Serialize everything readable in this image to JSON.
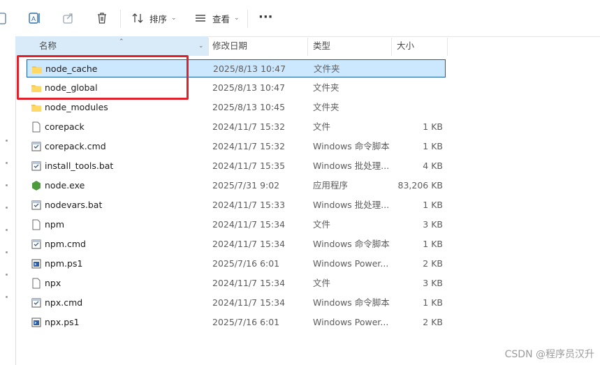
{
  "toolbar": {
    "sort_label": "排序",
    "view_label": "查看",
    "more_label": "···"
  },
  "columns": {
    "name": "名称",
    "date": "修改日期",
    "type": "类型",
    "size": "大小"
  },
  "files": [
    {
      "name": "node_cache",
      "date": "2025/8/13 10:47",
      "type": "文件夹",
      "size": "",
      "icon": "folder-icon"
    },
    {
      "name": "node_global",
      "date": "2025/8/13 10:47",
      "type": "文件夹",
      "size": "",
      "icon": "folder-icon"
    },
    {
      "name": "node_modules",
      "date": "2025/8/13 10:45",
      "type": "文件夹",
      "size": "",
      "icon": "folder-icon"
    },
    {
      "name": "corepack",
      "date": "2024/11/7 15:32",
      "type": "文件",
      "size": "1 KB",
      "icon": "file-icon"
    },
    {
      "name": "corepack.cmd",
      "date": "2024/11/7 15:32",
      "type": "Windows 命令脚本",
      "size": "1 KB",
      "icon": "script-icon"
    },
    {
      "name": "install_tools.bat",
      "date": "2024/11/7 15:35",
      "type": "Windows 批处理...",
      "size": "4 KB",
      "icon": "script-icon"
    },
    {
      "name": "node.exe",
      "date": "2025/7/31 9:02",
      "type": "应用程序",
      "size": "83,206 KB",
      "icon": "nodejs-icon"
    },
    {
      "name": "nodevars.bat",
      "date": "2024/11/7 15:33",
      "type": "Windows 批处理...",
      "size": "1 KB",
      "icon": "script-icon"
    },
    {
      "name": "npm",
      "date": "2024/11/7 15:34",
      "type": "文件",
      "size": "3 KB",
      "icon": "file-icon"
    },
    {
      "name": "npm.cmd",
      "date": "2024/11/7 15:34",
      "type": "Windows 命令脚本",
      "size": "1 KB",
      "icon": "script-icon"
    },
    {
      "name": "npm.ps1",
      "date": "2025/7/16 6:01",
      "type": "Windows Power...",
      "size": "2 KB",
      "icon": "powershell-icon"
    },
    {
      "name": "npx",
      "date": "2024/11/7 15:34",
      "type": "文件",
      "size": "3 KB",
      "icon": "file-icon"
    },
    {
      "name": "npx.cmd",
      "date": "2024/11/7 15:34",
      "type": "Windows 命令脚本",
      "size": "1 KB",
      "icon": "script-icon"
    },
    {
      "name": "npx.ps1",
      "date": "2025/7/16 6:01",
      "type": "Windows Power...",
      "size": "2 KB",
      "icon": "powershell-icon"
    }
  ],
  "selected_index": 0,
  "watermark": "CSDN @程序员汉升",
  "colors": {
    "accent": "#1b5fa8",
    "selection": "#cce8ff",
    "highlight": "#e0202a",
    "folder": "#f5c64a"
  }
}
